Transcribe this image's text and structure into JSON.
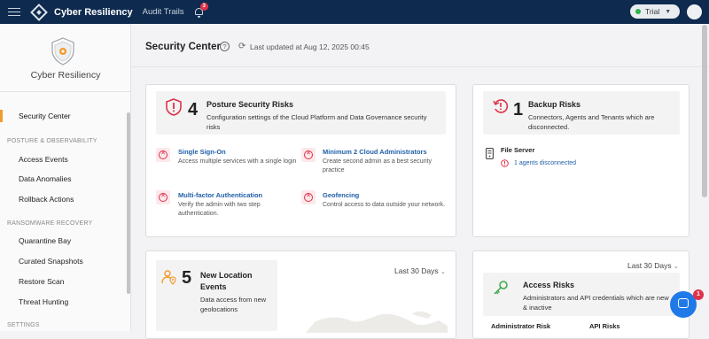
{
  "topbar": {
    "app_title": "Cyber Resiliency",
    "audit_trails": "Audit Trails",
    "notification_count": "3",
    "trial_label": "Trial"
  },
  "sidebar": {
    "brand": "Cyber Resiliency",
    "active_item": "Security Center",
    "section_posture": "POSTURE & OBSERVABILITY",
    "posture_items": [
      "Access Events",
      "Data Anomalies",
      "Rollback Actions"
    ],
    "section_ransomware": "RANSOMWARE RECOVERY",
    "ransomware_items": [
      "Quarantine Bay",
      "Curated Snapshots",
      "Restore Scan",
      "Threat Hunting"
    ],
    "section_settings": "SETTINGS"
  },
  "header": {
    "title": "Security Center",
    "last_updated": "Last updated at Aug 12, 2025 00:45"
  },
  "posture_card": {
    "count": "4",
    "title": "Posture Security Risks",
    "desc": "Configuration settings of the Cloud Platform and Data Governance security risks",
    "risks": [
      {
        "title": "Single Sign-On",
        "desc": "Access multiple services with a single login"
      },
      {
        "title": "Minimum 2 Cloud Administrators",
        "desc": "Create second admin as a best security practice"
      },
      {
        "title": "Multi-factor Authentication",
        "desc": "Verify the admin with two step authentication."
      },
      {
        "title": "Geofencing",
        "desc": "Control access to data outside your network."
      }
    ]
  },
  "backup_card": {
    "count": "1",
    "title": "Backup Risks",
    "desc": "Connectors, Agents and Tenants which are disconnected.",
    "item_title": "File Server",
    "item_link": "1 agents disconnected"
  },
  "location_card": {
    "count": "5",
    "title": "New Location Events",
    "desc": "Data access from new geolocations",
    "range": "Last 30 Days"
  },
  "access_card": {
    "range": "Last 30 Days",
    "title": "Access Risks",
    "desc": "Administrators and API credentials which are new & inactive",
    "col_admin": "Administrator Risk",
    "col_api": "API Risks"
  },
  "chat": {
    "badge": "1"
  },
  "colors": {
    "topbar": "#0e2a4e",
    "accent_orange": "#f29b2e",
    "risk_red": "#e0314a",
    "link_blue": "#1f5fa8",
    "success_green": "#2bb24c",
    "chat_blue": "#1f7ae8"
  }
}
